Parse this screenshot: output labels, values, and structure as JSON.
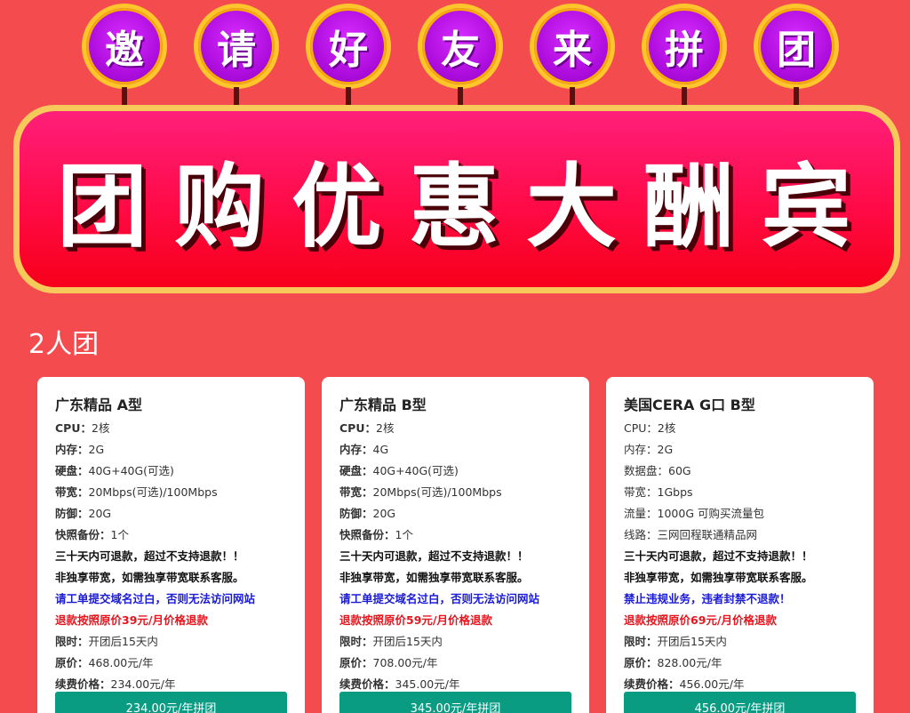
{
  "invite_chars": [
    "邀",
    "请",
    "好",
    "友",
    "来",
    "拼",
    "团"
  ],
  "banner_title": "团购优惠大酬宾",
  "section_title": "2人团",
  "colors": {
    "background": "#f34b4e",
    "circle": "#b10fe0",
    "circle_border": "#ffc62b",
    "banner": "#ff0a46",
    "button": "#0a9b83",
    "note_blue": "#1a1adb",
    "note_red": "#e8141e"
  },
  "cards": [
    {
      "title": "广东精品 A型",
      "specs": [
        {
          "k": "CPU：",
          "v": "2核"
        },
        {
          "k": "内存：",
          "v": "2G"
        },
        {
          "k": "硬盘：",
          "v": "40G+40G(可选)"
        },
        {
          "k": "带宽：",
          "v": "20Mbps(可选)/100Mbps"
        },
        {
          "k": "防御：",
          "v": "20G"
        },
        {
          "k": "快照备份：",
          "v": "1个"
        }
      ],
      "note_refund": "三十天内可退款，超过不支持退款！！",
      "note_bandwidth": "非独享带宽，如需独享带宽联系客服。",
      "note_blue": "请工单提交域名过白，否则无法访问网站",
      "note_red": "退款按照原价39元/月价格退款",
      "limit_k": "限时：",
      "limit_v": "开团后15天内",
      "price_k": "原价：",
      "price_v": "468.00元/年",
      "renew_k": "续费价格：",
      "renew_v": "234.00元/年",
      "button": "234.00元/年拼团"
    },
    {
      "title": "广东精品 B型",
      "specs": [
        {
          "k": "CPU：",
          "v": "2核"
        },
        {
          "k": "内存：",
          "v": "4G"
        },
        {
          "k": "硬盘：",
          "v": "40G+40G(可选)"
        },
        {
          "k": "带宽：",
          "v": "20Mbps(可选)/100Mbps"
        },
        {
          "k": "防御：",
          "v": "20G"
        },
        {
          "k": "快照备份：",
          "v": "1个"
        }
      ],
      "note_refund": "三十天内可退款，超过不支持退款！！",
      "note_bandwidth": "非独享带宽，如需独享带宽联系客服。",
      "note_blue": "请工单提交域名过白，否则无法访问网站",
      "note_red": "退款按照原价59元/月价格退款",
      "limit_k": "限时：",
      "limit_v": "开团后15天内",
      "price_k": "原价：",
      "price_v": "708.00元/年",
      "renew_k": "续费价格：",
      "renew_v": "345.00元/年",
      "button": "345.00元/年拼团"
    },
    {
      "title": "美国CERA G口 B型",
      "specs": [
        {
          "k": "CPU：",
          "v": "2核"
        },
        {
          "k": "内存：",
          "v": "2G"
        },
        {
          "k": "数据盘：",
          "v": "60G"
        },
        {
          "k": "带宽：",
          "v": "1Gbps"
        },
        {
          "k": "流量：",
          "v": "1000G 可购买流量包"
        },
        {
          "k": "线路：",
          "v": "三网回程联通精品网"
        }
      ],
      "note_refund": "三十天内可退款，超过不支持退款！！",
      "note_bandwidth": "非独享带宽，如需独享带宽联系客服。",
      "note_blue": "禁止违规业务，违者封禁不退款！",
      "note_red": "退款按照原价69元/月价格退款",
      "limit_k": "限时：",
      "limit_v": "开团后15天内",
      "price_k": "原价：",
      "price_v": "828.00元/年",
      "renew_k": "续费价格：",
      "renew_v": "456.00元/年",
      "button": "456.00元/年拼团"
    }
  ]
}
